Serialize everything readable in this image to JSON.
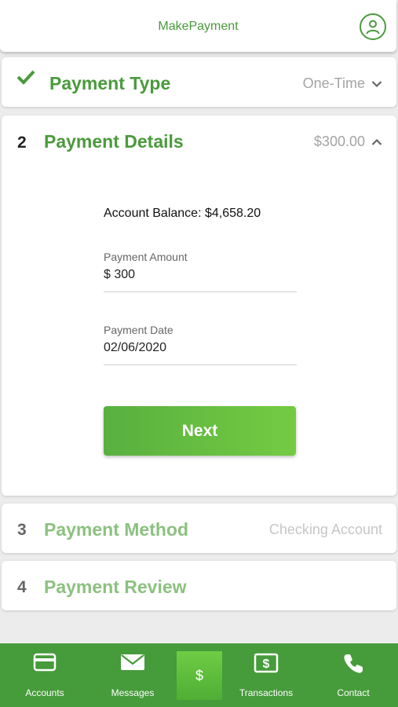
{
  "header": {
    "title": "MakePayment",
    "profile_icon": "user-circle-icon"
  },
  "steps": [
    {
      "number": "",
      "status": "complete",
      "title": "Payment Type",
      "value": "One-Time",
      "expanded": false
    },
    {
      "number": "2",
      "status": "active",
      "title": "Payment Details",
      "value": "$300.00",
      "expanded": true
    },
    {
      "number": "3",
      "status": "pending",
      "title": "Payment Method",
      "value": "Checking Account"
    },
    {
      "number": "4",
      "status": "pending",
      "title": "Payment Review",
      "value": ""
    }
  ],
  "details": {
    "balance": "Account Balance: $4,658.20",
    "amount_label": "Payment Amount",
    "amount_value": "$ 300",
    "date_label": "Payment Date",
    "date_value": "02/06/2020",
    "next_label": "Next"
  },
  "nav": {
    "items": [
      {
        "label": "Accounts",
        "icon": "credit-card-icon"
      },
      {
        "label": "Messages",
        "icon": "envelope-icon"
      },
      {
        "label": "",
        "icon": "dollar-icon",
        "symbol": "$"
      },
      {
        "label": "Transactions",
        "icon": "dollar-bill-icon"
      },
      {
        "label": "Contact",
        "icon": "phone-icon"
      }
    ]
  },
  "colors": {
    "accent": "#4a9a3c",
    "nav_bg": "#469b3a",
    "button_start": "#58b040",
    "button_end": "#74cb42"
  }
}
